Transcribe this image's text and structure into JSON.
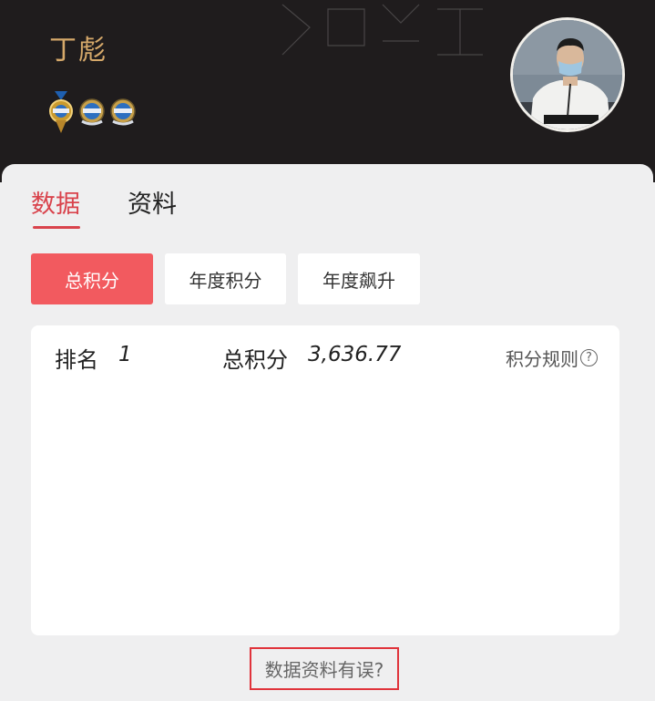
{
  "header": {
    "player_name": "丁彪",
    "badges": [
      {
        "icon": "gold-medal-badge-icon"
      },
      {
        "icon": "blue-medal-badge-icon"
      },
      {
        "icon": "blue-medal-badge-icon"
      }
    ],
    "avatar_icon": "player-avatar"
  },
  "tabs": [
    {
      "label": "数据",
      "active": true
    },
    {
      "label": "资料",
      "active": false
    }
  ],
  "segments": {
    "total": "总积分",
    "year": "年度积分",
    "rise": "年度飙升"
  },
  "stats": {
    "rank_label": "排名",
    "rank_value": "1",
    "total_label": "总积分",
    "total_value": "3,636.77",
    "rules_label": "积分规则",
    "help_icon": "question-circle-icon",
    "help_glyph": "?"
  },
  "footer": {
    "error_link": "数据资料有误?"
  },
  "colors": {
    "header_bg": "#1f1c1d",
    "name_gold": "#d6a96a",
    "accent_red": "#d9434c",
    "segment_active": "#f25a5f",
    "highlight_border": "#e0333b"
  }
}
